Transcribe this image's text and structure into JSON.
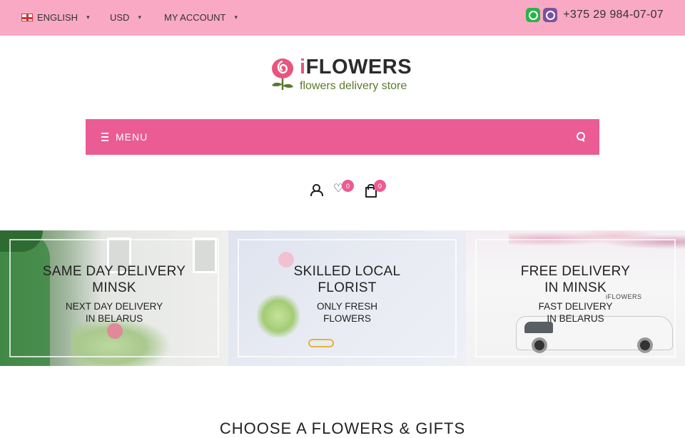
{
  "topbar": {
    "language": "ENGLISH",
    "currency": "USD",
    "account": "MY ACCOUNT",
    "phone": "+375 29 984-07-07",
    "icons": [
      "whatsapp-icon",
      "viber-icon",
      "uk-flag-icon",
      "chevron-down-icon"
    ]
  },
  "logo": {
    "brand_i": "i",
    "brand_rest": "FLOWERS",
    "tagline": "flowers delivery store"
  },
  "menubar": {
    "label": "MENU",
    "icons": [
      "bars-icon",
      "search-icon"
    ]
  },
  "header_icons": {
    "wishlist_count": "0",
    "cart_count": "0"
  },
  "banners": [
    {
      "title_line1": "SAME DAY DELIVERY",
      "title_line2": "MINSK",
      "sub_line1": "NEXT DAY DELIVERY",
      "sub_line2": "IN BELARUS"
    },
    {
      "title_line1": "SKILLED LOCAL",
      "title_line2": "FLORIST",
      "sub_line1": "ONLY FRESH",
      "sub_line2": "FLOWERS"
    },
    {
      "title_line1": "FREE DELIVERY",
      "title_line2": "IN MINSK",
      "sub_line1": "FAST DELIVERY",
      "sub_line2": "IN BELARUS",
      "van_logo": "iFLOWERS"
    }
  ],
  "section": {
    "title": "CHOOSE A FLOWERS & GIFTS"
  },
  "colors": {
    "topbar": "#f9a9c4",
    "menubar": "#ea5c93",
    "accent": "#e8547e",
    "tagline": "#5a7a2e"
  }
}
